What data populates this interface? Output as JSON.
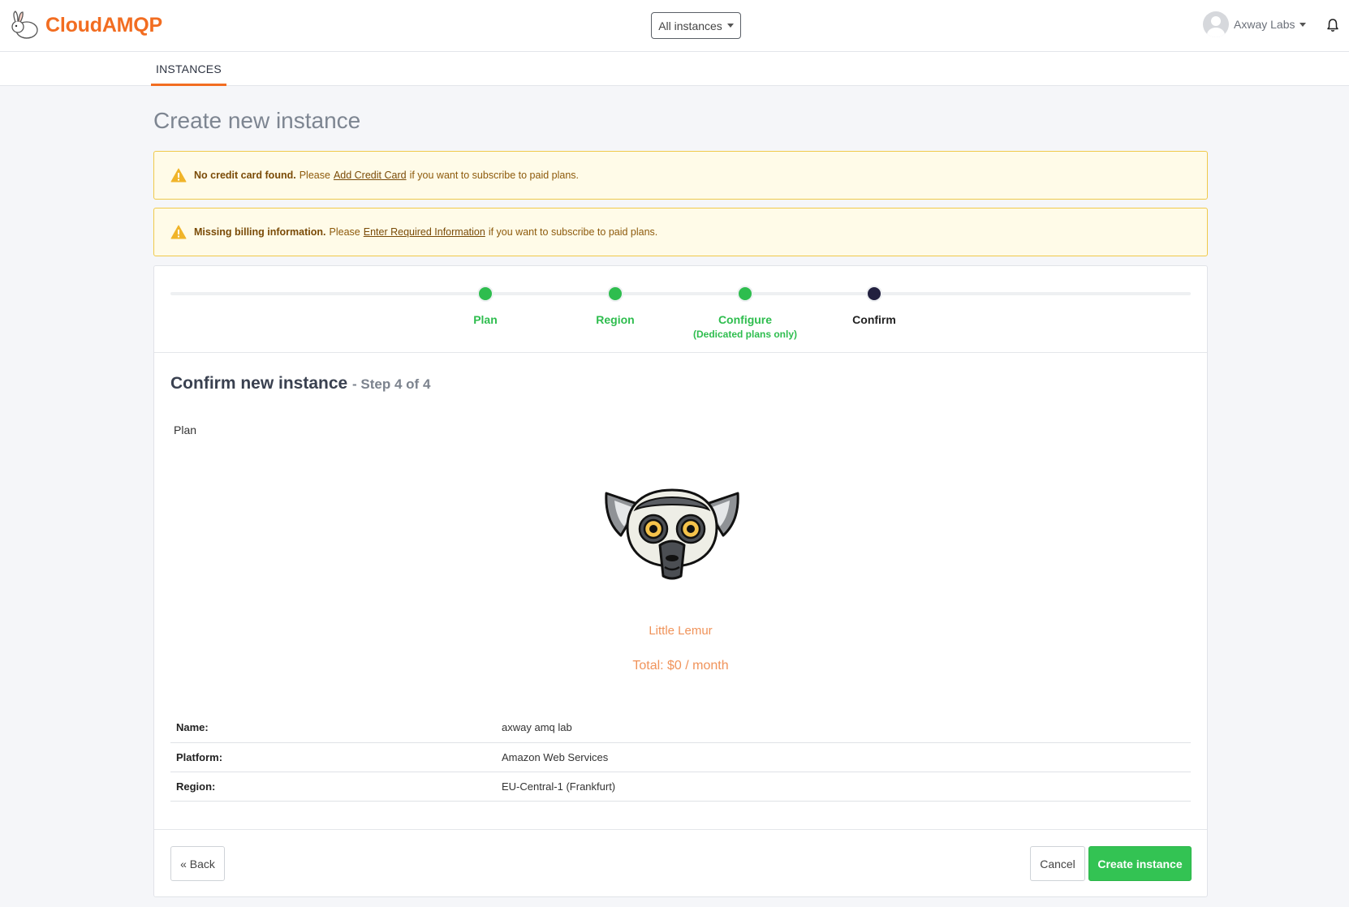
{
  "header": {
    "brand": "CloudAMQP",
    "instance_filter": "All instances",
    "user_name": "Axway Labs"
  },
  "nav": {
    "tab_instances": "INSTANCES"
  },
  "page": {
    "title": "Create new instance"
  },
  "alerts": [
    {
      "bold": "No credit card found.",
      "before": "Please",
      "link": "Add Credit Card",
      "after": "if you want to subscribe to paid plans."
    },
    {
      "bold": "Missing billing information.",
      "before": "Please",
      "link": "Enter Required Information",
      "after": "if you want to subscribe to paid plans."
    }
  ],
  "steps": [
    {
      "label": "Plan",
      "sub": "",
      "state": "done"
    },
    {
      "label": "Region",
      "sub": "",
      "state": "done"
    },
    {
      "label": "Configure",
      "sub": "(Dedicated plans only)",
      "state": "done"
    },
    {
      "label": "Confirm",
      "sub": "",
      "state": "current"
    }
  ],
  "confirm": {
    "title": "Confirm new instance",
    "step_text": "- Step 4 of 4",
    "plan_label": "Plan",
    "plan_name": "Little Lemur",
    "total": "Total: $0 / month"
  },
  "details": [
    {
      "key": "Name:",
      "value": "axway amq lab"
    },
    {
      "key": "Platform:",
      "value": "Amazon Web Services"
    },
    {
      "key": "Region:",
      "value": "EU-Central-1 (Frankfurt)"
    }
  ],
  "buttons": {
    "back": "« Back",
    "cancel": "Cancel",
    "create": "Create instance"
  },
  "colors": {
    "brand": "#f26d21",
    "success": "#2ebd4e",
    "current_step": "#22203f",
    "plan_accent": "#f0935a",
    "alert_bg": "#fffbe8",
    "alert_border": "#f0c94a"
  }
}
